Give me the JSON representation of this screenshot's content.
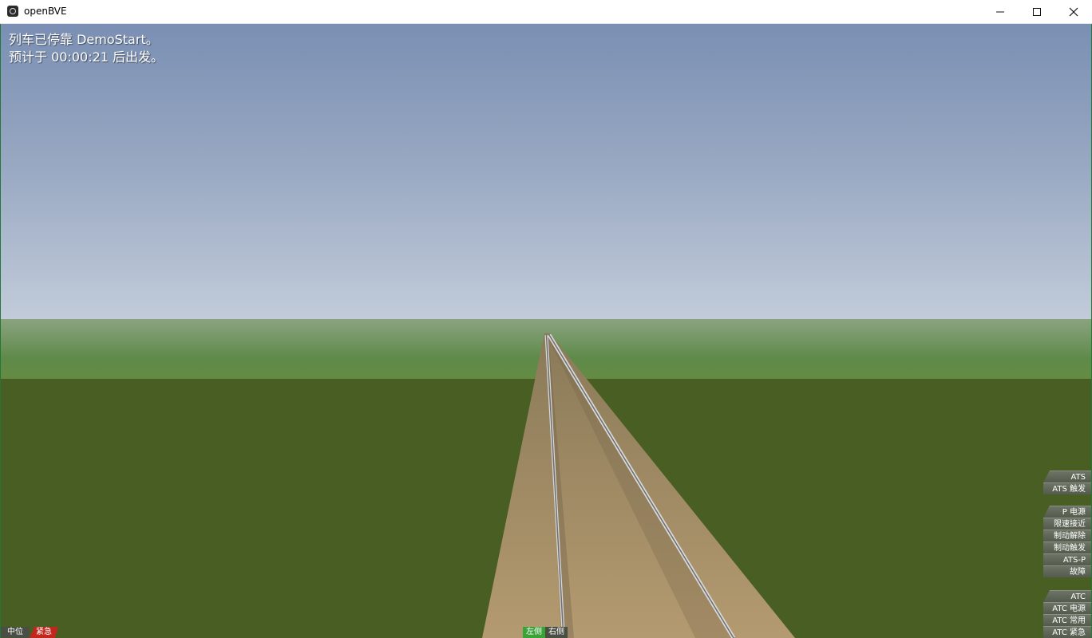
{
  "window": {
    "title": "openBVE",
    "icon": "openbve-app-icon",
    "controls": [
      "minimize-icon",
      "maximize-icon",
      "close-icon"
    ]
  },
  "messages": [
    "列车已停靠 DemoStart。",
    "预计于 00:00:21 后出发。"
  ],
  "ats_panel": {
    "items": [
      "ATS",
      "ATS 触发"
    ]
  },
  "atsp_panel": {
    "items": [
      "P 电源",
      "限速接近",
      "制动解除",
      "制动触发",
      "ATS-P",
      "故障"
    ]
  },
  "atc_panel": {
    "items": [
      "ATC",
      "ATC 电源",
      "ATC 常用",
      "ATC 紧急"
    ]
  },
  "reverser": {
    "label": "中位",
    "color": "#4a4f44"
  },
  "brake": {
    "label": "紧急",
    "color": "#c0281e"
  },
  "doors": {
    "left_label": "左侧",
    "right_label": "右侧",
    "left_color": "#3aa336",
    "right_color": "#4a4f44"
  },
  "colors": {
    "sky_top": "#7a8fb3",
    "grass": "#485e22",
    "panel_bg": "#5f6657"
  }
}
